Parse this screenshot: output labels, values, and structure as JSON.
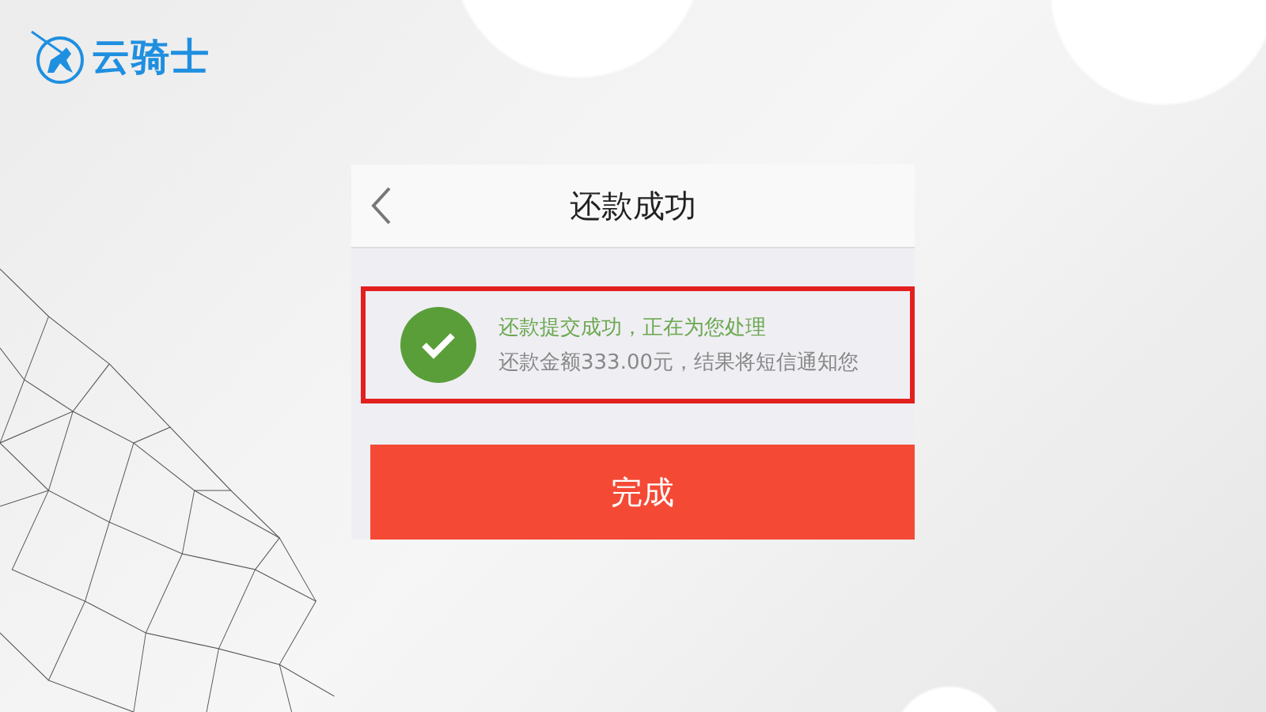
{
  "logo": {
    "text": "云骑士"
  },
  "screen": {
    "title": "还款成功",
    "notice": {
      "highlighted": true,
      "title": "还款提交成功，正在为您处理",
      "detail": "还款金额333.00元，结果将短信通知您"
    },
    "button": {
      "label": "完成"
    }
  }
}
